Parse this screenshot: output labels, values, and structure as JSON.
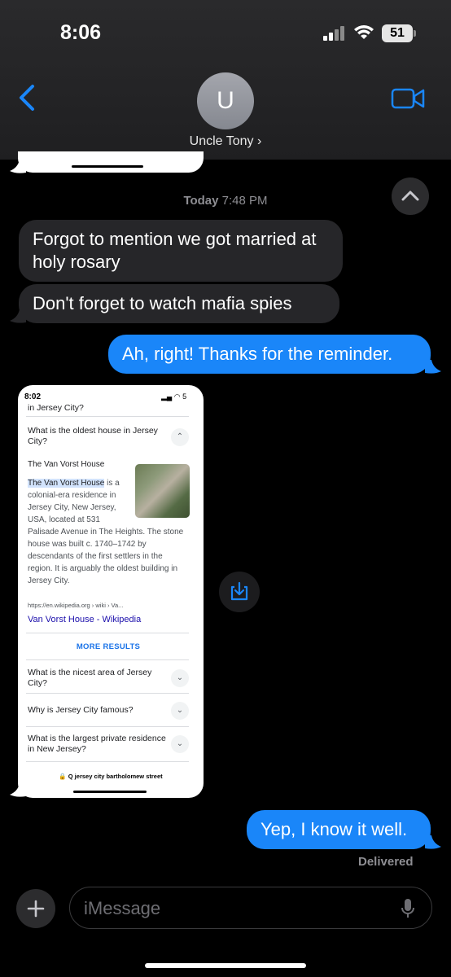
{
  "status_bar": {
    "time": "8:06",
    "battery": "51"
  },
  "header": {
    "contact_initial": "U",
    "contact_name": "Uncle Tony ›"
  },
  "thread": {
    "timestamp_day": "Today",
    "timestamp_time": "7:48 PM",
    "messages": [
      {
        "direction": "in",
        "text": "Forgot to mention we got married at holy rosary"
      },
      {
        "direction": "in",
        "text": "Don't forget to watch mafia spies"
      },
      {
        "direction": "out",
        "text": "Ah, right! Thanks for the reminder."
      },
      {
        "direction": "out",
        "text": "Yep, I know it well."
      }
    ],
    "delivered": "Delivered"
  },
  "screenshot": {
    "time": "8:02",
    "status_icons": "▂▄ ◠ 5",
    "top_text": "in Jersey City?",
    "q1": "What is the oldest house in Jersey City?",
    "answer_title": "The Van Vorst House",
    "answer_highlight": "The Van Vorst House",
    "answer_rest_1": " is a",
    "answer_body_lines": [
      "colonial-era residence in",
      "Jersey City, New Jersey,",
      "USA, located at 531",
      "Palisade Avenue in The Heights. The stone",
      "house was built c. 1740–1742 by",
      "descendants of the first settlers in the",
      "region. It is arguably the oldest building in",
      "Jersey City."
    ],
    "source_url": "https://en.wikipedia.org › wiki › Va...",
    "source_link": "Van Vorst House - Wikipedia",
    "more_results": "MORE RESULTS",
    "q2": "What is the nicest area of Jersey City?",
    "q3": "Why is Jersey City famous?",
    "q4": "What is the largest private residence in New Jersey?",
    "address_bar": "🔒 Q jersey city bartholomew street"
  },
  "composer": {
    "placeholder": "iMessage"
  },
  "colors": {
    "outgoing": "#1a86f9",
    "incoming": "#262629",
    "accent": "#1a86f9"
  },
  "icons": [
    "back-chevron-icon",
    "video-camera-icon",
    "chevron-up-icon",
    "download-icon",
    "plus-icon",
    "microphone-icon"
  ]
}
